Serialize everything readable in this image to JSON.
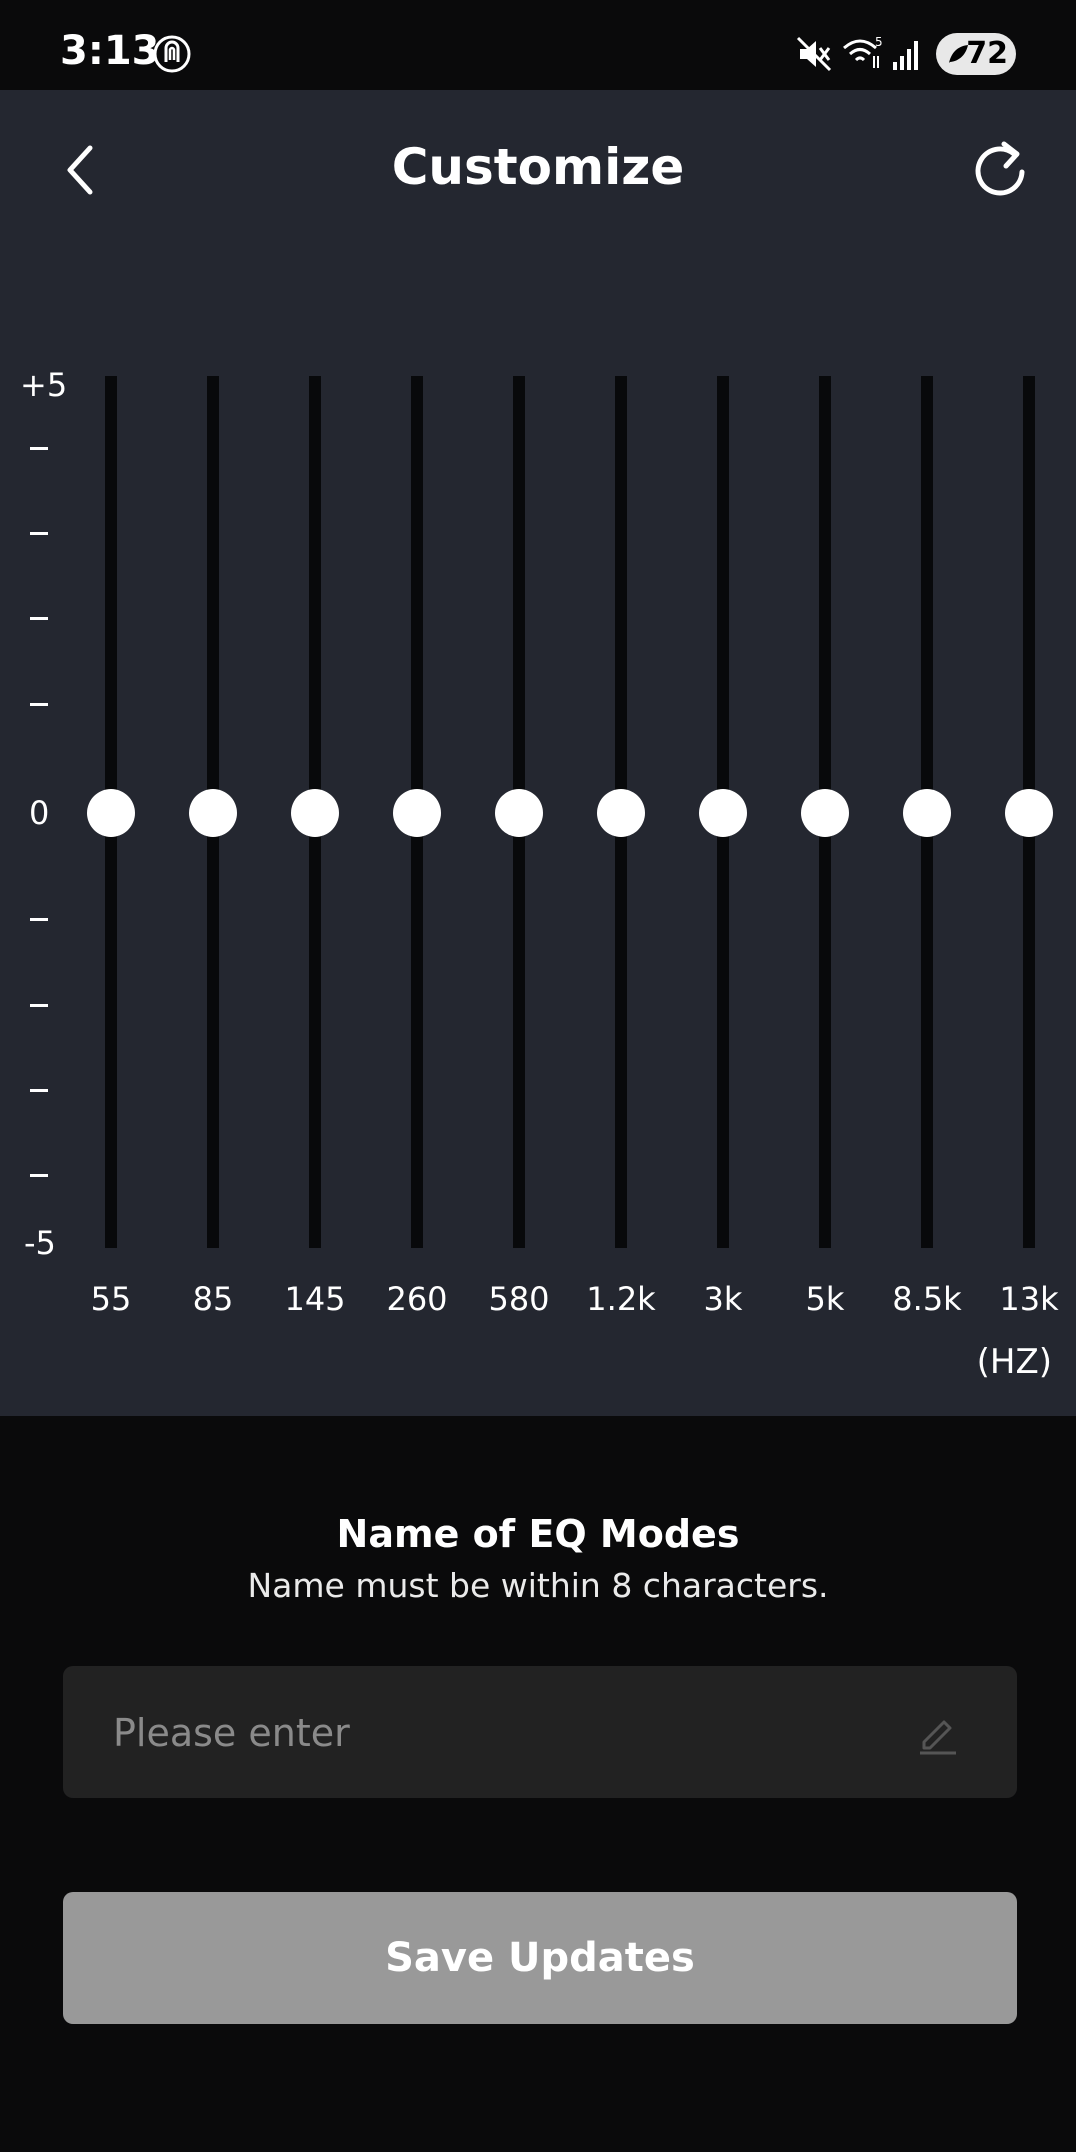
{
  "status_bar": {
    "time": "3:13",
    "battery": "72",
    "wifi_badge": "5"
  },
  "header": {
    "title": "Customize"
  },
  "eq": {
    "scale_top": "+5",
    "scale_mid": "0",
    "scale_bottom": "-5",
    "unit": "(HZ)",
    "bands": [
      {
        "freq": "55",
        "gain": 0
      },
      {
        "freq": "85",
        "gain": 0
      },
      {
        "freq": "145",
        "gain": 0
      },
      {
        "freq": "260",
        "gain": 0
      },
      {
        "freq": "580",
        "gain": 0
      },
      {
        "freq": "1.2k",
        "gain": 0
      },
      {
        "freq": "3k",
        "gain": 0
      },
      {
        "freq": "5k",
        "gain": 0
      },
      {
        "freq": "8.5k",
        "gain": 0
      },
      {
        "freq": "13k",
        "gain": 0
      }
    ]
  },
  "form": {
    "title": "Name of EQ Modes",
    "hint": "Name must be within 8 characters.",
    "name_value": "",
    "name_placeholder": "Please enter",
    "save_label": "Save Updates"
  }
}
